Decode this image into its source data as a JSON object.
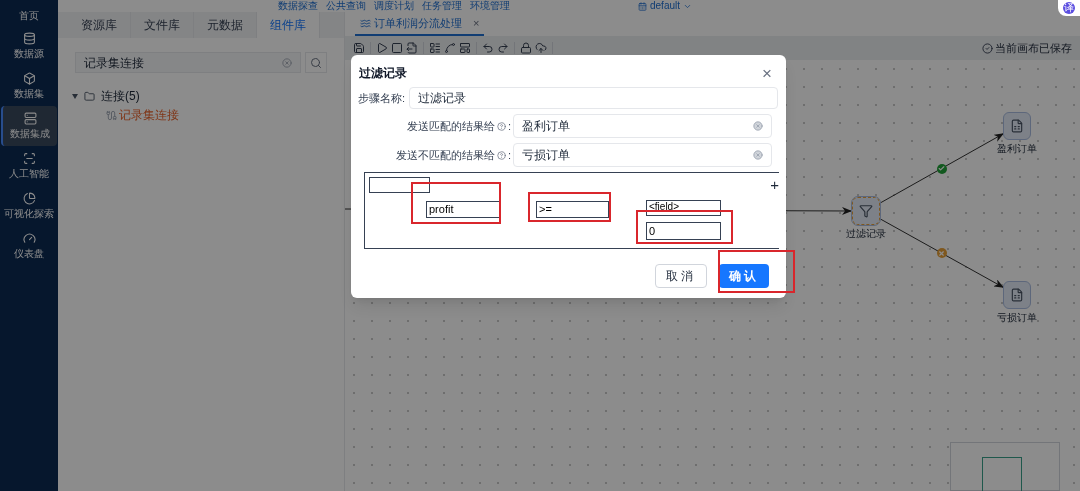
{
  "top_nav": {
    "links": [
      "数据探查",
      "公共查询",
      "调度计划",
      "任务管理",
      "环境管理"
    ],
    "workspace": "default",
    "badge": "译"
  },
  "sidebar": {
    "items": [
      {
        "label": "首页",
        "selected": false
      },
      {
        "label": "数据源",
        "selected": false
      },
      {
        "label": "数据集",
        "selected": false
      },
      {
        "label": "数据集成",
        "selected": true
      },
      {
        "label": "人工智能",
        "selected": false
      },
      {
        "label": "可视化探索",
        "selected": false
      },
      {
        "label": "仪表盘",
        "selected": false
      }
    ]
  },
  "panel": {
    "tabs": [
      {
        "label": "资源库",
        "selected": false
      },
      {
        "label": "文件库",
        "selected": false
      },
      {
        "label": "元数据",
        "selected": false
      },
      {
        "label": "组件库",
        "selected": true
      }
    ],
    "search": {
      "value": "记录集连接"
    },
    "tree": [
      {
        "label": "连接(5)",
        "expanded": true,
        "children": [
          {
            "label": "记录集连接",
            "selected": true
          }
        ]
      }
    ]
  },
  "editor": {
    "tabs": [
      {
        "label": "订单利润分流处理",
        "selected": true,
        "close": "×"
      }
    ],
    "status": "当前画布已保存",
    "nodes": [
      {
        "kind": "filter",
        "label": "过滤记录",
        "selected": true
      },
      {
        "kind": "output",
        "label": "盈利订单",
        "selected": false
      },
      {
        "kind": "output",
        "label": "亏损订单",
        "selected": false
      }
    ],
    "edges": [
      {
        "kind": "input"
      },
      {
        "kind": "match"
      },
      {
        "kind": "mismatch"
      }
    ]
  },
  "dialog": {
    "title": "过滤记录",
    "close": "×",
    "step_name": {
      "label": "步骤名称:",
      "value": "过滤记录"
    },
    "targets": [
      {
        "label": "发送匹配的结果给",
        "colon": ":",
        "value": "盈利订单"
      },
      {
        "label": "发送不匹配的结果给",
        "colon": ":",
        "value": "亏损订单"
      }
    ],
    "condition": {
      "field": "profit",
      "operator": ">=",
      "compare_field": "<field>",
      "value": "0",
      "add": "+"
    },
    "buttons": [
      {
        "label": "取消",
        "kind": "default"
      },
      {
        "label": "确认",
        "kind": "primary"
      }
    ]
  }
}
